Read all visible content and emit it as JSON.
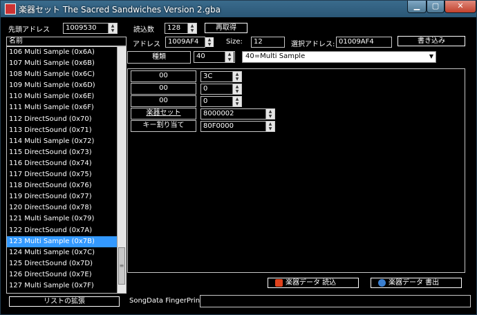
{
  "window": {
    "title": "楽器セット The Sacred Sandwiches Version 2.gba",
    "min_glyph": "▁",
    "max_glyph": "▢",
    "close_glyph": "✕"
  },
  "top": {
    "head_address_label": "先頭アドレス",
    "head_address_value": "1009530",
    "read_count_label": "読込数",
    "read_count_value": "128",
    "reload_button": "再取得"
  },
  "list": {
    "header": "名前",
    "items": [
      "106 Multi Sample (0x6A)",
      "107 Multi Sample (0x6B)",
      "108 Multi Sample (0x6C)",
      "109 Multi Sample (0x6D)",
      "110 Multi Sample (0x6E)",
      "111 Multi Sample (0x6F)",
      "112 DirectSound (0x70)",
      "113 DirectSound (0x71)",
      "114 Multi Sample (0x72)",
      "115 DirectSound (0x73)",
      "116 DirectSound (0x74)",
      "117 DirectSound (0x75)",
      "118 DirectSound (0x76)",
      "119 DirectSound (0x77)",
      "120 DirectSound (0x78)",
      "121 Multi Sample (0x79)",
      "122 DirectSound (0x7A)",
      "123 Multi Sample (0x7B)",
      "124 Multi Sample (0x7C)",
      "125 DirectSound (0x7D)",
      "126 DirectSound (0x7E)",
      "127 Multi Sample (0x7F)"
    ],
    "selected_index": 17,
    "expand_button": "リストの拡張",
    "scroll_grip": "≡"
  },
  "detail": {
    "address_label": "アドレス",
    "address_value": "1009AF4",
    "size_label": "Size:",
    "size_value": "12",
    "selected_address_label": "選択アドレス:",
    "selected_address_value": "01009AF4",
    "write_button": "書き込み",
    "type_label": "種類",
    "type_value": "40",
    "type_dropdown": "40=Multi Sample",
    "rows": [
      {
        "label": "00",
        "value": "3C"
      },
      {
        "label": "00",
        "value": "0"
      },
      {
        "label": "00",
        "value": "0"
      },
      {
        "label": "楽器セット",
        "value": "8000002"
      },
      {
        "label": "キー割り当て",
        "value": "80F0000"
      }
    ]
  },
  "bottom": {
    "import_button": "楽器データ 読込",
    "export_button": "楽器データ 書出",
    "fingerprint_label": "SongData FingerPrint",
    "fingerprint_value": ""
  },
  "colors": {
    "selection": "#3399ff",
    "background": "#000000",
    "import_icon": "#e0421c",
    "export_icon": "#3a7fd0"
  },
  "icons": {
    "spin_up": "▲",
    "spin_down": "▼",
    "dropdown": "▼"
  }
}
